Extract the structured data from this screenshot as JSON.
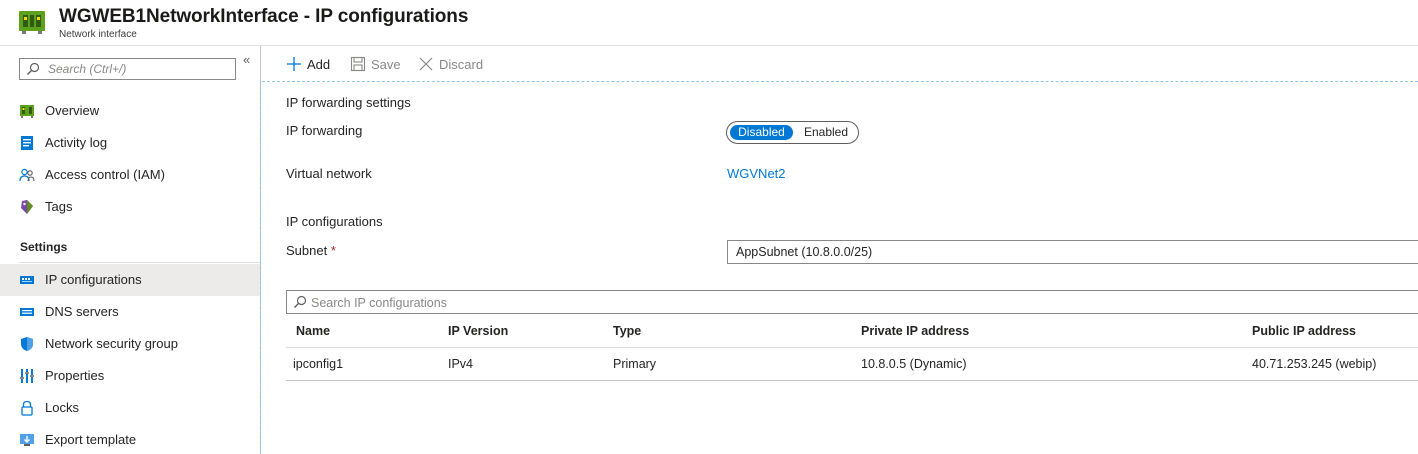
{
  "header": {
    "title": "WGWEB1NetworkInterface - IP configurations",
    "subtitle": "Network interface",
    "icon": "network-interface-icon"
  },
  "sidebar": {
    "search_placeholder": "Search (Ctrl+/)",
    "collapse_glyph": "«",
    "items": [
      {
        "label": "Overview",
        "icon": "network-interface-icon"
      },
      {
        "label": "Activity log",
        "icon": "activity-log-icon"
      },
      {
        "label": "Access control (IAM)",
        "icon": "people-icon"
      },
      {
        "label": "Tags",
        "icon": "tag-icon"
      }
    ],
    "section_label": "Settings",
    "settings_items": [
      {
        "label": "IP configurations",
        "icon": "ip-config-icon",
        "active": true
      },
      {
        "label": "DNS servers",
        "icon": "dns-icon"
      },
      {
        "label": "Network security group",
        "icon": "shield-icon"
      },
      {
        "label": "Properties",
        "icon": "properties-icon"
      },
      {
        "label": "Locks",
        "icon": "lock-icon"
      },
      {
        "label": "Export template",
        "icon": "export-template-icon"
      }
    ]
  },
  "toolbar": {
    "add_label": "Add",
    "save_label": "Save",
    "discard_label": "Discard"
  },
  "main": {
    "ip_forwarding_section": "IP forwarding settings",
    "ip_forwarding_label": "IP forwarding",
    "toggle": {
      "disabled_label": "Disabled",
      "enabled_label": "Enabled",
      "selected": "Disabled"
    },
    "virtual_network_label": "Virtual network",
    "virtual_network_value": "WGVNet2",
    "ip_config_section": "IP configurations",
    "subnet_label": "Subnet",
    "subnet_required": "*",
    "subnet_value": "AppSubnet (10.8.0.0/25)",
    "search_placeholder": "Search IP configurations"
  },
  "table": {
    "columns": [
      "Name",
      "IP Version",
      "Type",
      "Private IP address",
      "Public IP address"
    ],
    "rows": [
      [
        "ipconfig1",
        "IPv4",
        "Primary",
        "10.8.0.5 (Dynamic)",
        "40.71.253.245 (webip)"
      ]
    ]
  },
  "colors": {
    "accent": "#0078d4",
    "required": "#a4262c",
    "active_nav_bg": "#edebe9",
    "resource_icon_green": "#5ea11f"
  }
}
